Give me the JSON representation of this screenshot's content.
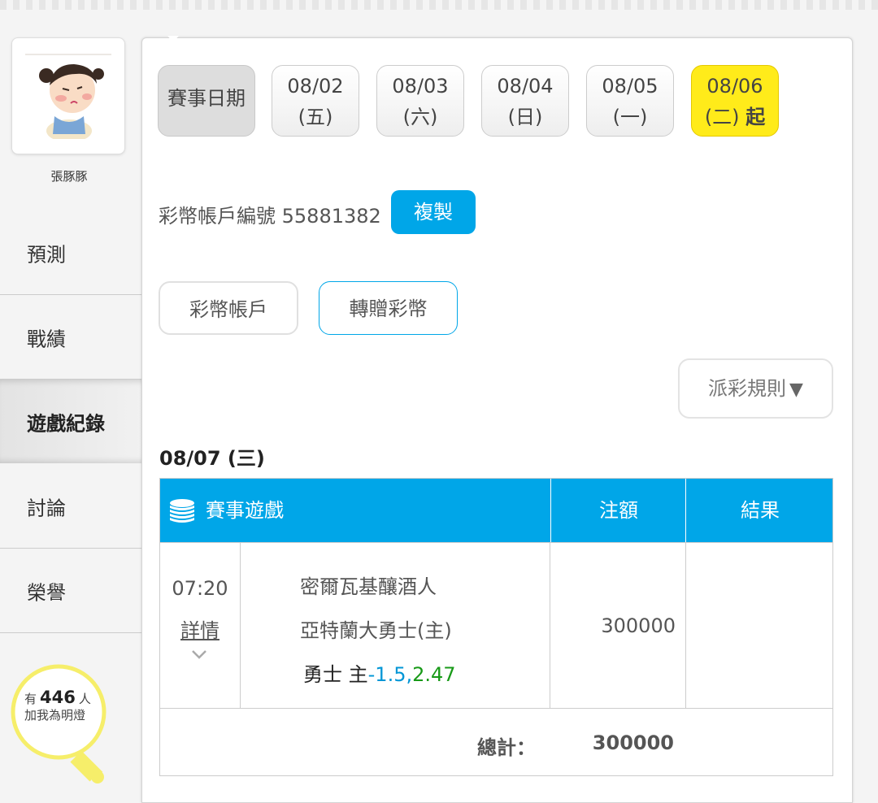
{
  "sidebar": {
    "user_name": "張豚豚",
    "nav": [
      {
        "label": "預測"
      },
      {
        "label": "戰績"
      },
      {
        "label": "遊戲紀錄"
      },
      {
        "label": "討論"
      },
      {
        "label": "榮譽"
      }
    ],
    "lamp": {
      "prefix": "有",
      "count": "446",
      "suffix": "人",
      "line2": "加我為明燈"
    }
  },
  "dates": {
    "label": "賽事日期",
    "items": [
      {
        "date": "08/02",
        "day": "(五)"
      },
      {
        "date": "08/03",
        "day": "(六)"
      },
      {
        "date": "08/04",
        "day": "(日)"
      },
      {
        "date": "08/05",
        "day": "(一)"
      },
      {
        "date": "08/06",
        "day": "(二)",
        "suffix": "起"
      }
    ]
  },
  "account": {
    "label": "彩幣帳戶編號",
    "number": "55881382",
    "copy_label": "複製"
  },
  "tabs": {
    "account": "彩幣帳戶",
    "transfer": "轉贈彩幣"
  },
  "rules_label": "派彩規則",
  "section_date": "08/07 (三)",
  "table": {
    "headers": {
      "game": "賽事遊戲",
      "amount": "注額",
      "result": "結果"
    },
    "rows": [
      {
        "time": "07:20",
        "detail": "詳情",
        "team1": "密爾瓦基釀酒人",
        "team2": "亞特蘭大勇士(主)",
        "pick": "勇士 主",
        "spread": "-1.5,",
        "odds": "2.47",
        "amount": "300000",
        "result": ""
      }
    ],
    "total_label": "總計：",
    "total_value": "300000"
  },
  "colors": {
    "accent": "#00a6e8",
    "highlight": "#ffeb1a",
    "spread": "#0096d6",
    "odds": "#189a18"
  }
}
